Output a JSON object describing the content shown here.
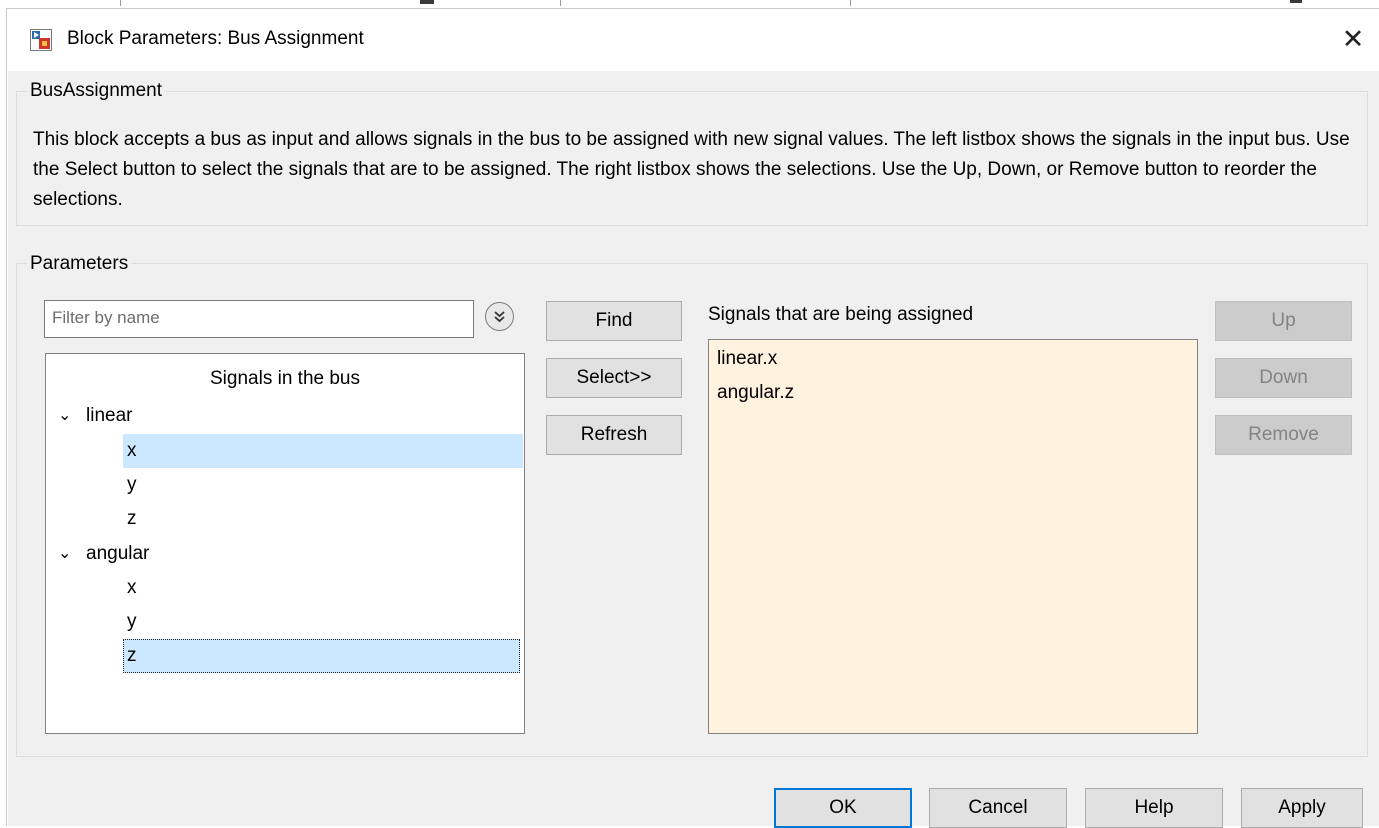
{
  "window": {
    "title": "Block Parameters: Bus Assignment"
  },
  "description": {
    "group_label": "BusAssignment",
    "text": "This block accepts a bus as input and allows signals in the bus to be assigned with new signal values. The left listbox shows the signals in the input bus. Use the Select button to select the signals that are to be assigned. The right listbox shows the selections. Use the Up, Down, or Remove button to reorder the selections."
  },
  "parameters": {
    "group_label": "Parameters",
    "filter": {
      "placeholder": "Filter by name",
      "value": ""
    },
    "tree": {
      "header": "Signals in the bus",
      "groups": [
        {
          "label": "linear",
          "expanded": true,
          "children": [
            "x",
            "y",
            "z"
          ]
        },
        {
          "label": "angular",
          "expanded": true,
          "children": [
            "x",
            "y",
            "z"
          ]
        }
      ],
      "selected": [
        "linear.x",
        "angular.z"
      ],
      "focused": "angular.z"
    },
    "buttons": {
      "find": "Find",
      "select": "Select>>",
      "refresh": "Refresh"
    },
    "assigned": {
      "label": "Signals that are being assigned",
      "items": [
        "linear.x",
        "angular.z"
      ]
    },
    "order_buttons": {
      "up": "Up",
      "down": "Down",
      "remove": "Remove",
      "enabled": false
    }
  },
  "footer": {
    "ok": "OK",
    "cancel": "Cancel",
    "help": "Help",
    "apply": "Apply"
  },
  "colors": {
    "dialog_background": "#f0f0f0",
    "selection": "#cce8ff",
    "assigned_list_background": "#fff2de",
    "default_button_border": "#0078d7"
  }
}
